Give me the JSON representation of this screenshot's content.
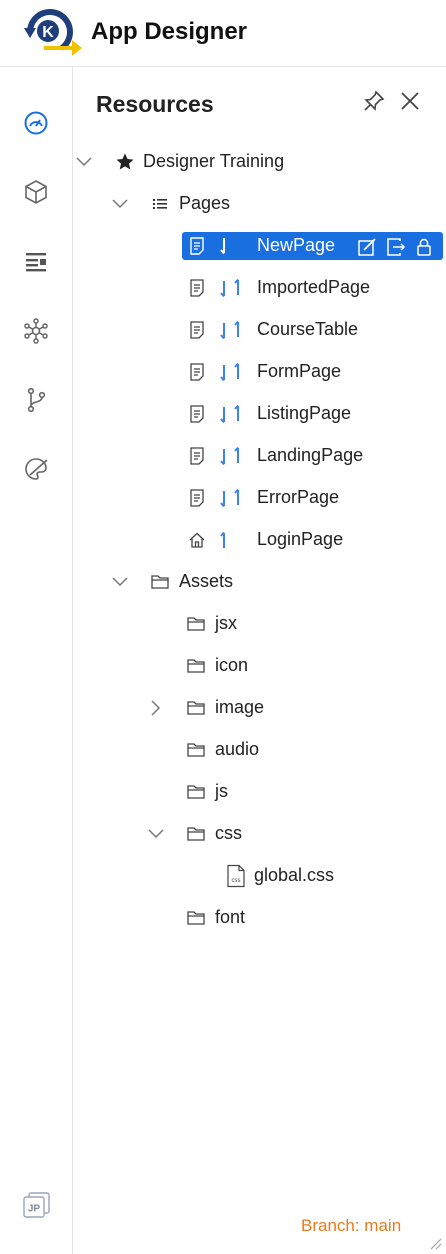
{
  "header": {
    "title": "App Designer",
    "logo_letter": "K"
  },
  "rail": {
    "items": [
      {
        "icon": "dashboard-gauge-icon",
        "active": true
      },
      {
        "icon": "cube-icon",
        "active": false
      },
      {
        "icon": "layout-list-icon",
        "active": false
      },
      {
        "icon": "network-graph-icon",
        "active": false
      },
      {
        "icon": "git-branch-icon",
        "active": false
      },
      {
        "icon": "palette-brush-icon",
        "active": false
      }
    ],
    "bottom": {
      "icon": "language-jp-icon",
      "label": "JP"
    }
  },
  "panel": {
    "title": "Resources",
    "tree": {
      "root_label": "Designer Training",
      "pages_label": "Pages",
      "pages": [
        "NewPage",
        "ImportedPage",
        "CourseTable",
        "FormPage",
        "ListingPage",
        "LandingPage",
        "ErrorPage",
        "LoginPage"
      ],
      "assets_label": "Assets",
      "assets": [
        "jsx",
        "icon",
        "image",
        "audio",
        "js",
        "css",
        "font"
      ],
      "css_file": "global.css",
      "css_file_badge": "css"
    }
  },
  "footer": {
    "branch": "Branch: main"
  },
  "colors": {
    "accent": "#1a6fe0",
    "branch": "#ea7a1e",
    "arrow": "#3b82f6"
  }
}
